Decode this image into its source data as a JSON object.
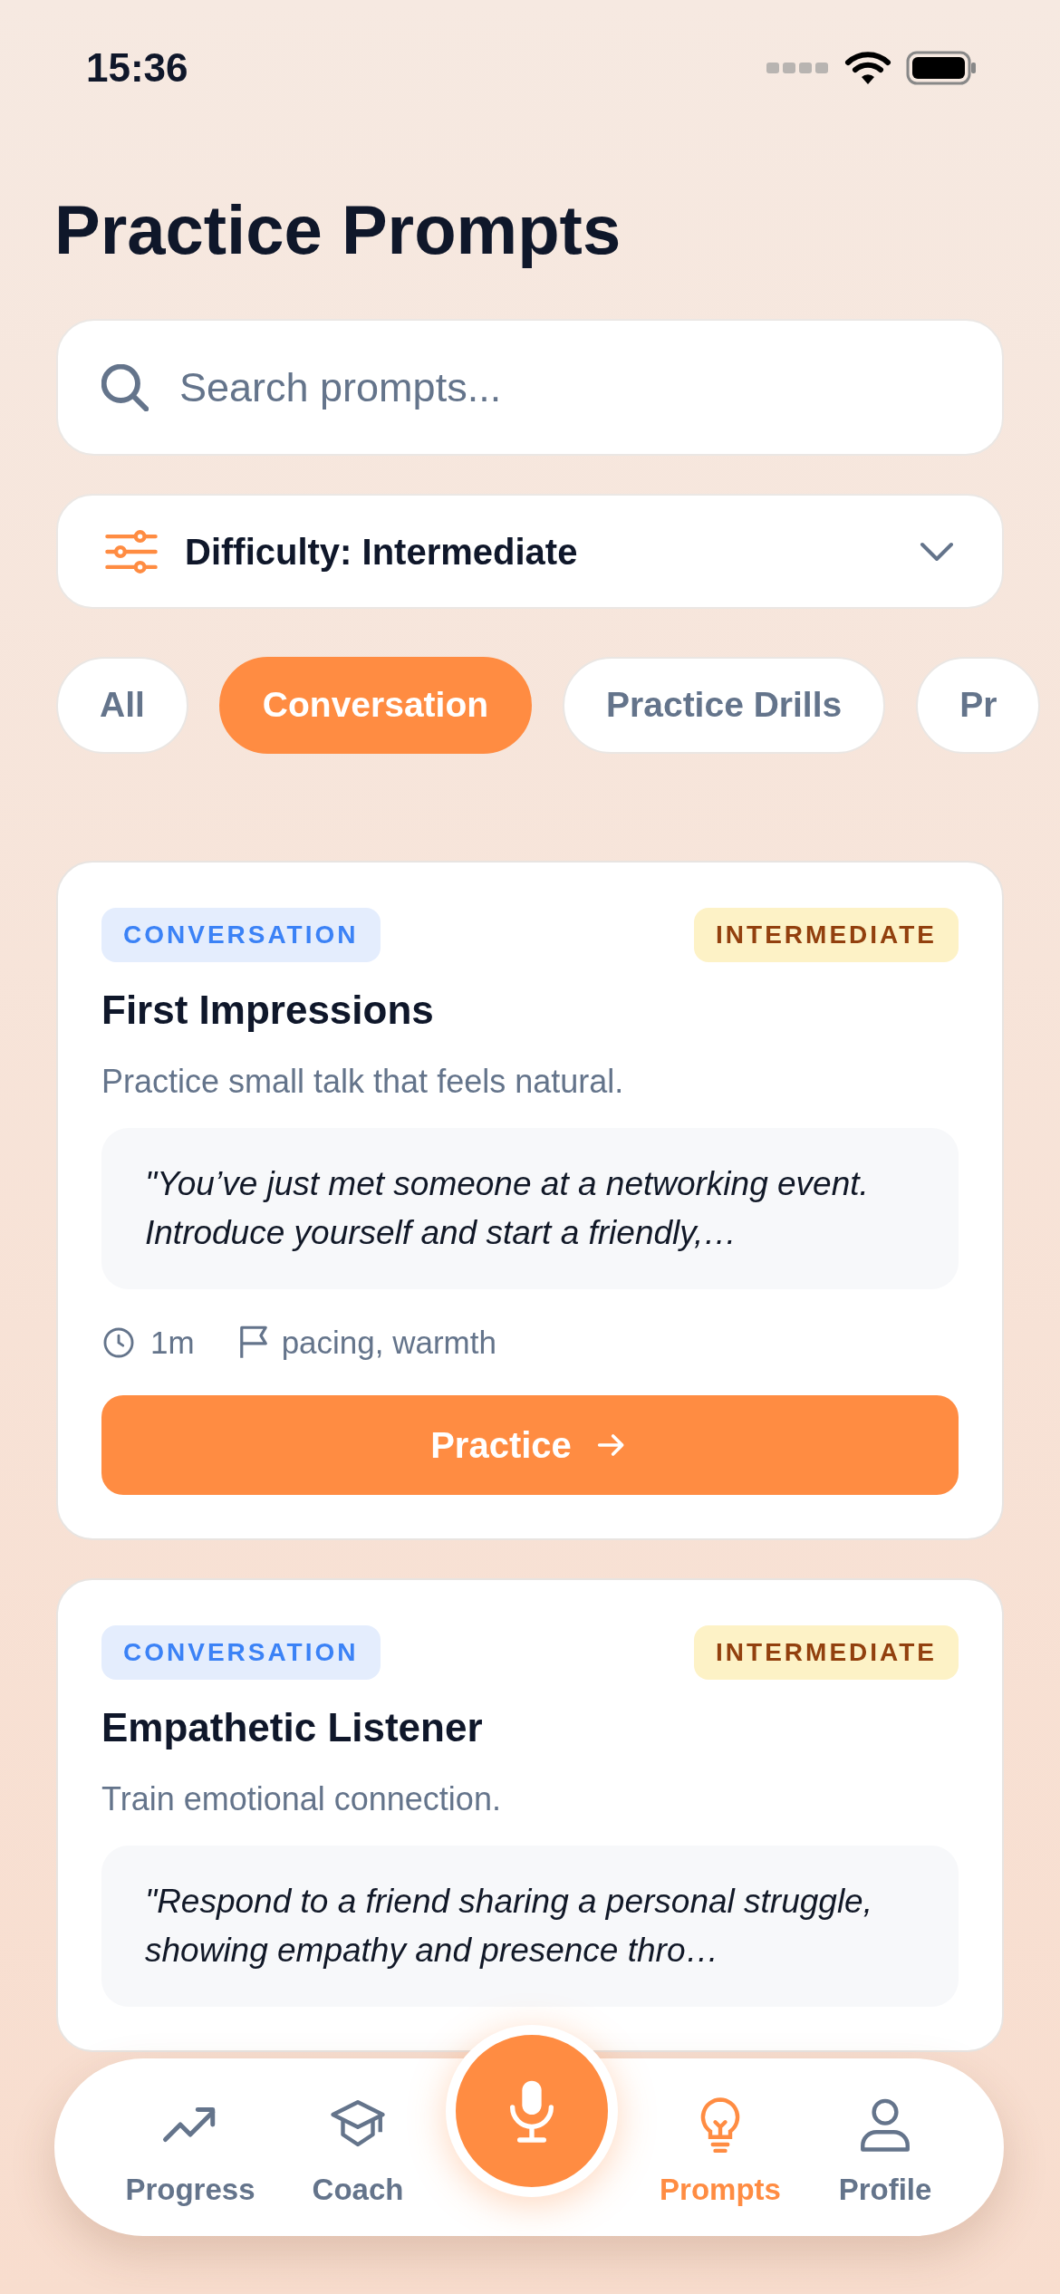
{
  "status_bar": {
    "time": "15:36"
  },
  "title": "Practice Prompts",
  "search": {
    "placeholder": "Search prompts..."
  },
  "difficulty_filter": {
    "label": "Difficulty: Intermediate"
  },
  "category_chips": [
    {
      "label": "All",
      "selected": false
    },
    {
      "label": "Conversation",
      "selected": true
    },
    {
      "label": "Practice Drills",
      "selected": false
    },
    {
      "label": "Pr",
      "selected": false
    }
  ],
  "prompts": [
    {
      "category": "CONVERSATION",
      "difficulty": "INTERMEDIATE",
      "title": "First Impressions",
      "description": "Practice small talk that feels natural.",
      "quote": "\"You’ve just met someone at a networking event. Introduce yourself and start a friendly,…",
      "duration": "1m",
      "skills": "pacing, warmth",
      "action": "Practice"
    },
    {
      "category": "CONVERSATION",
      "difficulty": "INTERMEDIATE",
      "title": "Empathetic Listener",
      "description": "Train emotional connection.",
      "quote": "\"Respond to a friend sharing a personal struggle, showing empathy and presence thro…"
    }
  ],
  "tab_bar": {
    "items": [
      {
        "label": "Progress",
        "selected": false
      },
      {
        "label": "Coach",
        "selected": false
      },
      {
        "label": "Prompts",
        "selected": true
      },
      {
        "label": "Profile",
        "selected": false
      }
    ]
  }
}
